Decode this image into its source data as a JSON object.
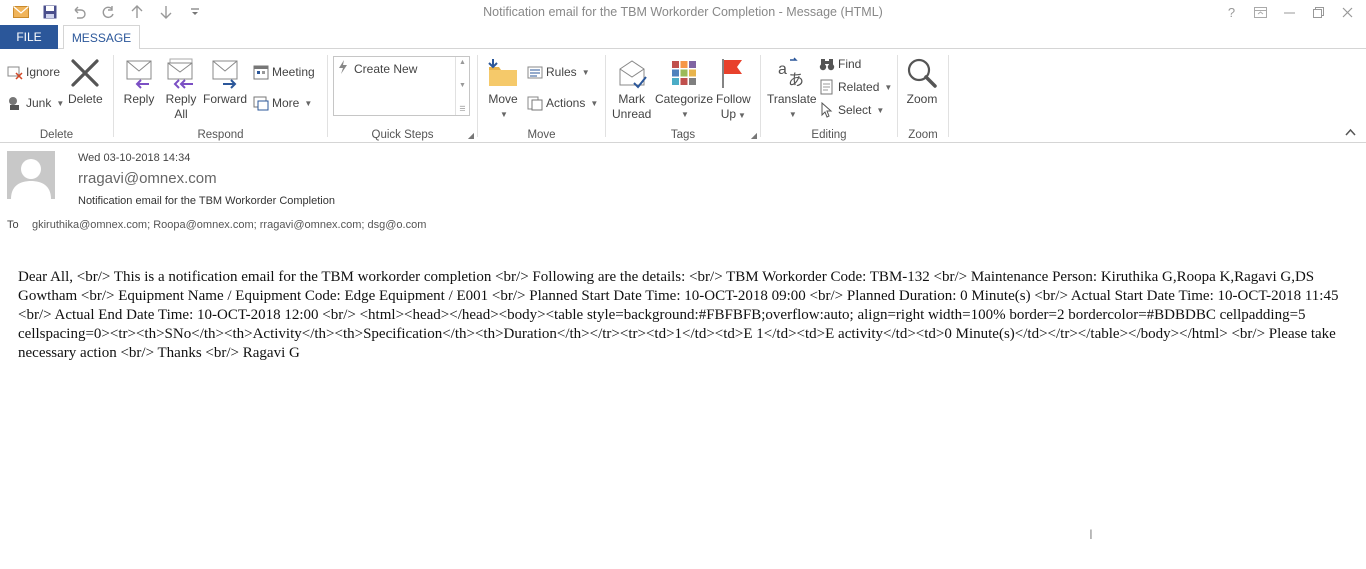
{
  "window": {
    "title": "Notification email for the TBM Workorder Completion - Message (HTML)",
    "controls": [
      "?",
      "restore-ribbon",
      "minimize",
      "maximize",
      "close"
    ]
  },
  "qat": {
    "icons": [
      "outlook-icon",
      "save-icon",
      "undo-icon",
      "redo-icon",
      "up-icon",
      "down-icon",
      "customize-icon"
    ]
  },
  "tabs": {
    "file": "FILE",
    "message": "MESSAGE"
  },
  "ribbon": {
    "delete_group": {
      "label": "Delete",
      "ignore": "Ignore",
      "junk": "Junk",
      "delete": "Delete"
    },
    "respond_group": {
      "label": "Respond",
      "reply": "Reply",
      "reply_all_1": "Reply",
      "reply_all_2": "All",
      "forward": "Forward",
      "meeting": "Meeting",
      "more": "More"
    },
    "quicksteps_group": {
      "label": "Quick Steps",
      "create_new": "Create New"
    },
    "move_group": {
      "label": "Move",
      "move": "Move",
      "rules": "Rules",
      "actions": "Actions"
    },
    "tags_group": {
      "label": "Tags",
      "mark_unread_1": "Mark",
      "mark_unread_2": "Unread",
      "categorize": "Categorize",
      "follow_up_1": "Follow",
      "follow_up_2": "Up"
    },
    "editing_group": {
      "label": "Editing",
      "translate": "Translate",
      "find": "Find",
      "related": "Related",
      "select": "Select"
    },
    "zoom_group": {
      "label": "Zoom",
      "zoom": "Zoom"
    }
  },
  "message": {
    "date": "Wed 03-10-2018 14:34",
    "from": "rragavi@omnex.com",
    "subject": "Notification email for the TBM Workorder Completion",
    "to_label": "To",
    "to": "gkiruthika@omnex.com; Roopa@omnex.com; rragavi@omnex.com; dsg@o.com",
    "body": "Dear All, <br/> This is a notification email for the TBM workorder completion <br/> Following are the details: <br/> TBM Workorder Code: TBM-132 <br/> Maintenance Person: Kiruthika G,Roopa K,Ragavi G,DS Gowtham <br/> Equipment Name / Equipment Code: Edge Equipment / E001 <br/> Planned Start Date Time: 10-OCT-2018 09:00 <br/> Planned Duration: 0 Minute(s) <br/> Actual Start Date Time: 10-OCT-2018 11:45 <br/> Actual End Date Time: 10-OCT-2018 12:00 <br/> <html><head></head><body><table style=background:#FBFBFB;overflow:auto; align=right width=100% border=2 bordercolor=#BDBDBC cellpadding=5 cellspacing=0><tr><th>SNo</th><th>Activity</th><th>Specification</th><th>Duration</th></tr><tr><td>1</td><td>E 1</td><td>E activity</td><td>0 Minute(s)</td></tr></table></body></html> <br/> Please take necessary action <br/> Thanks <br/> Ragavi G"
  },
  "colors": {
    "accent": "#2b579a",
    "flag": "#e8412c",
    "arrow": "#7b4fc4"
  }
}
